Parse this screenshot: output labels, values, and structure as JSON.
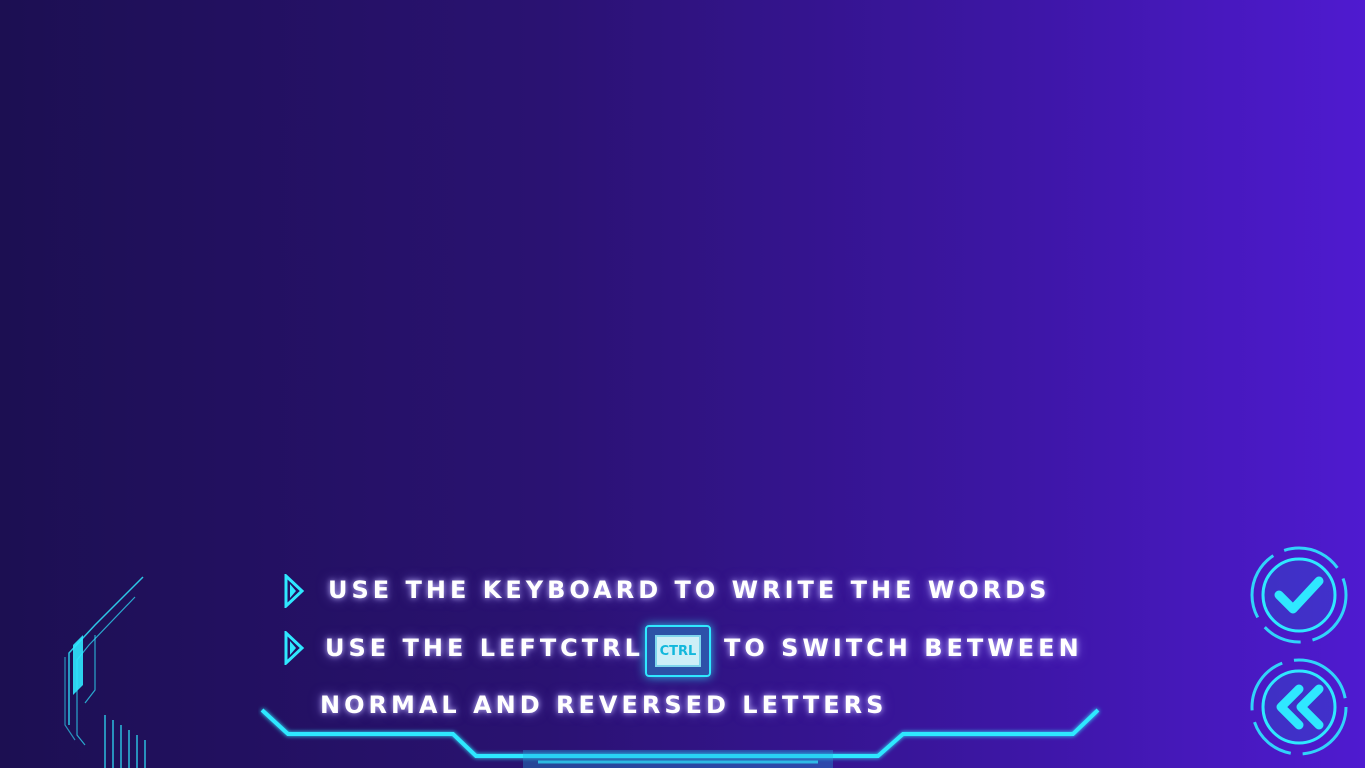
{
  "instructions": {
    "line1": "USE THE KEYBOARD  TO  WRITE  THE  WORDS",
    "line2_before": "USE THE LEFTCTRL",
    "key_label": "CTRL",
    "line2_after": "TO SWITCH BETWEEN",
    "line3": "NORMAL AND REVERSED LETTERS"
  },
  "buttons": {
    "confirm_icon": "checkmark-icon",
    "back_icon": "double-chevron-left-icon"
  },
  "colors": {
    "accent": "#2fe8ff",
    "text": "#ffffff",
    "background_left": "#1c0f52",
    "background_right": "#4f1ad0"
  }
}
